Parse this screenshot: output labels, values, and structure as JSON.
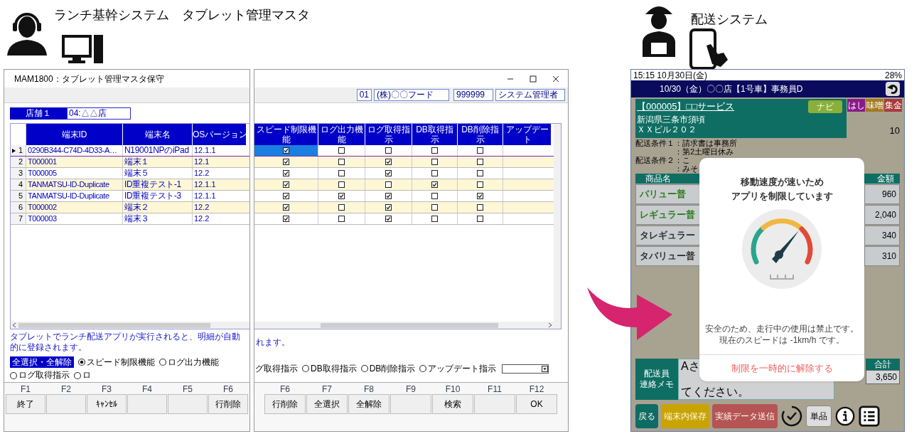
{
  "left_header": {
    "title": "ランチ基幹システム　タブレット管理マスタ"
  },
  "right_header": {
    "title": "配送システム"
  },
  "admin_window": {
    "title": "MAM1800：タブレット管理マスタ保守",
    "company": {
      "code": "01",
      "name": "(株)〇〇フード"
    },
    "user": {
      "code": "999999",
      "name": "システム管理者"
    },
    "store": {
      "label": "店舗１",
      "value": "04:△△店"
    },
    "table": {
      "left_columns": [
        "端末ID",
        "端末名",
        "OSバージョン"
      ],
      "right_columns": [
        "スピード制限機能",
        "ログ出力機能",
        "ログ取得指示",
        "DB取得指示",
        "DB削除指示",
        "アップデート"
      ],
      "rows": [
        {
          "number": "1",
          "terminal_id": "0290B344-C74D-4D33-A…",
          "terminal_name": "N19001NPのiPad",
          "os_version": "12.1.1",
          "selected": true,
          "checks": [
            {
              "checked": true
            },
            {
              "checked": false
            },
            {
              "checked": false
            },
            {
              "checked": false
            },
            {
              "checked": false
            }
          ]
        },
        {
          "number": "2",
          "terminal_id": "T000001",
          "terminal_name": "端末１",
          "os_version": "12.1",
          "selected": false,
          "checks": [
            {
              "checked": true
            },
            {
              "checked": false
            },
            {
              "checked": true
            },
            {
              "checked": false
            },
            {
              "checked": false
            }
          ]
        },
        {
          "number": "3",
          "terminal_id": "T000005",
          "terminal_name": "端末５",
          "os_version": "12.2",
          "selected": false,
          "checks": [
            {
              "checked": true
            },
            {
              "checked": false
            },
            {
              "checked": true
            },
            {
              "checked": false
            },
            {
              "checked": false
            }
          ]
        },
        {
          "number": "4",
          "terminal_id": "TANMATSU-ID-Duplicate",
          "terminal_name": "ID重複テスト-1",
          "os_version": "12.1.1",
          "selected": false,
          "checks": [
            {
              "checked": true
            },
            {
              "checked": false
            },
            {
              "checked": false
            },
            {
              "checked": true
            },
            {
              "checked": false
            }
          ]
        },
        {
          "number": "5",
          "terminal_id": "TANMATSU-ID-Duplicate",
          "terminal_name": "ID重複テスト-3",
          "os_version": "12.1.1",
          "selected": false,
          "checks": [
            {
              "checked": true
            },
            {
              "checked": true
            },
            {
              "checked": true
            },
            {
              "checked": false
            },
            {
              "checked": true
            }
          ]
        },
        {
          "number": "6",
          "terminal_id": "T000002",
          "terminal_name": "端末２",
          "os_version": "12.2",
          "selected": false,
          "checks": [
            {
              "checked": true
            },
            {
              "checked": false
            },
            {
              "checked": true
            },
            {
              "checked": false
            },
            {
              "checked": false
            }
          ]
        },
        {
          "number": "7",
          "terminal_id": "T000003",
          "terminal_name": "端末３",
          "os_version": "12.2",
          "selected": false,
          "checks": [
            {
              "checked": true
            },
            {
              "checked": false
            },
            {
              "checked": true
            },
            {
              "checked": false
            },
            {
              "checked": false
            }
          ]
        }
      ]
    },
    "left_message": "タブレットでランチ配送アプリが実行されると、明細が自動的に登録されます。",
    "right_message": "れます。",
    "select_all_button": "全選択・全解除",
    "left_radios": [
      {
        "kind": "radio",
        "label": "スピード制限機能",
        "selected": true
      },
      {
        "kind": "radio",
        "label": "ログ出力機能",
        "selected": false
      },
      {
        "kind": "radio",
        "label": "ログ取得指示",
        "selected": false
      },
      {
        "kind": "radio",
        "label": "ロ",
        "selected": false
      }
    ],
    "right_radios": [
      {
        "kind": "fragment",
        "label": "グ取得指示"
      },
      {
        "kind": "radio",
        "label": "DB取得指示",
        "selected": false
      },
      {
        "kind": "radio",
        "label": "DB削除指示",
        "selected": false
      },
      {
        "kind": "radio",
        "label": "アップデート指示",
        "selected": false
      }
    ],
    "left_function_keys": [
      {
        "key": "F1",
        "label": "終了"
      },
      {
        "key": "F2"
      },
      {
        "key": "F3",
        "label": "ｷｬﾝｾﾙ"
      },
      {
        "key": "F4"
      },
      {
        "key": "F5"
      },
      {
        "key": "F6",
        "label": "行削除"
      }
    ],
    "right_function_keys": [
      {
        "key": "F6",
        "label": "行削除"
      },
      {
        "key": "F7",
        "label": "全選択"
      },
      {
        "key": "F8",
        "label": "全解除"
      },
      {
        "key": "F9"
      },
      {
        "key": "F10",
        "label": "検索"
      },
      {
        "key": "F11"
      },
      {
        "key": "F12",
        "label": "OK"
      }
    ]
  },
  "tablet": {
    "status": {
      "time": "15:15  10月30日(金)",
      "battery": "28%"
    },
    "header": "10/30（金）〇〇店【1号車】事務員D",
    "customer": {
      "name": "【000005】□□サービス",
      "nav_button": "ナビ",
      "address": [
        "新潟県三条市須頃",
        "ＸＸビル２０２"
      ],
      "count": "10"
    },
    "tags": [
      {
        "label": "はし",
        "color": "#8a1a8a"
      },
      {
        "label": "味噌",
        "color": "#a27a22"
      },
      {
        "label": "集金",
        "color": "#a83a3a"
      }
    ],
    "conditions": [
      {
        "label": "配送条件１",
        "lines": [
          "：請求書は事務所",
          "：第2土曜日休み"
        ]
      },
      {
        "label": "配送条件２",
        "lines": [
          "：こ",
          "：みそ"
        ]
      }
    ],
    "items": {
      "columns": [
        "商品名",
        "金額"
      ],
      "rows": [
        {
          "name": "バリュー普",
          "amount": "960",
          "color": "#2e7d1e"
        },
        {
          "name": "レギュラー普",
          "amount": "2,040",
          "color": "#2e7d1e"
        },
        {
          "name": "タレギュラー",
          "amount": "340",
          "color": "#333333"
        },
        {
          "name": "タバリュー普",
          "amount": "310",
          "color": "#333333"
        }
      ]
    },
    "memo": {
      "label": [
        "配送員",
        "連絡メモ"
      ],
      "lines": [
        "Aさ",
        "てください。"
      ]
    },
    "total": {
      "label": "合計",
      "value": "3,650"
    },
    "buttons": [
      {
        "label": "戻る",
        "color": "#0f6b66"
      },
      {
        "label": "端末内保存",
        "color": "#c9a400"
      },
      {
        "label": "実績データ送信",
        "color": "#b55454"
      }
    ],
    "single_button": "単品",
    "dialog": {
      "title": [
        "移動速度が速いため",
        "アプリを制限しています"
      ],
      "message": [
        "安全のため、走行中の使用は禁止です。",
        "現在のスピードは -1km/h です。"
      ],
      "action": "制限を一時的に解除する"
    }
  }
}
